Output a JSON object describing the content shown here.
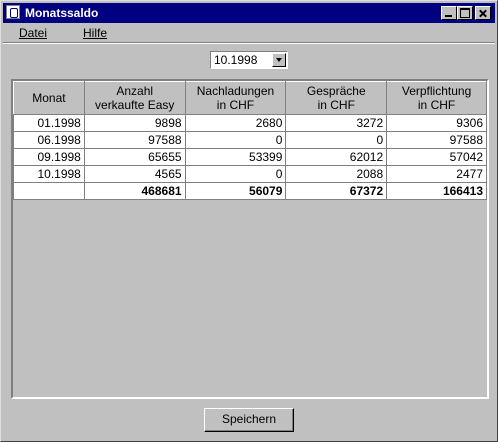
{
  "window": {
    "title": "Monatssaldo"
  },
  "menu": {
    "items": [
      "Datei",
      "Hilfe"
    ]
  },
  "filter": {
    "selected_month": "10.1998"
  },
  "table": {
    "headers": [
      [
        "Monat"
      ],
      [
        "Anzahl",
        "verkaufte Easy"
      ],
      [
        "Nachladungen",
        "in CHF"
      ],
      [
        "Gespräche",
        "in CHF"
      ],
      [
        "Verpflichtung",
        "in CHF"
      ]
    ],
    "rows": [
      [
        "01.1998",
        "9898",
        "2680",
        "3272",
        "9306"
      ],
      [
        "06.1998",
        "97588",
        "0",
        "0",
        "97588"
      ],
      [
        "09.1998",
        "65655",
        "53399",
        "62012",
        "57042"
      ],
      [
        "10.1998",
        "4565",
        "0",
        "2088",
        "2477"
      ]
    ],
    "totals": [
      "",
      "468681",
      "56079",
      "67372",
      "166413"
    ]
  },
  "actions": {
    "save_label": "Speichern"
  }
}
